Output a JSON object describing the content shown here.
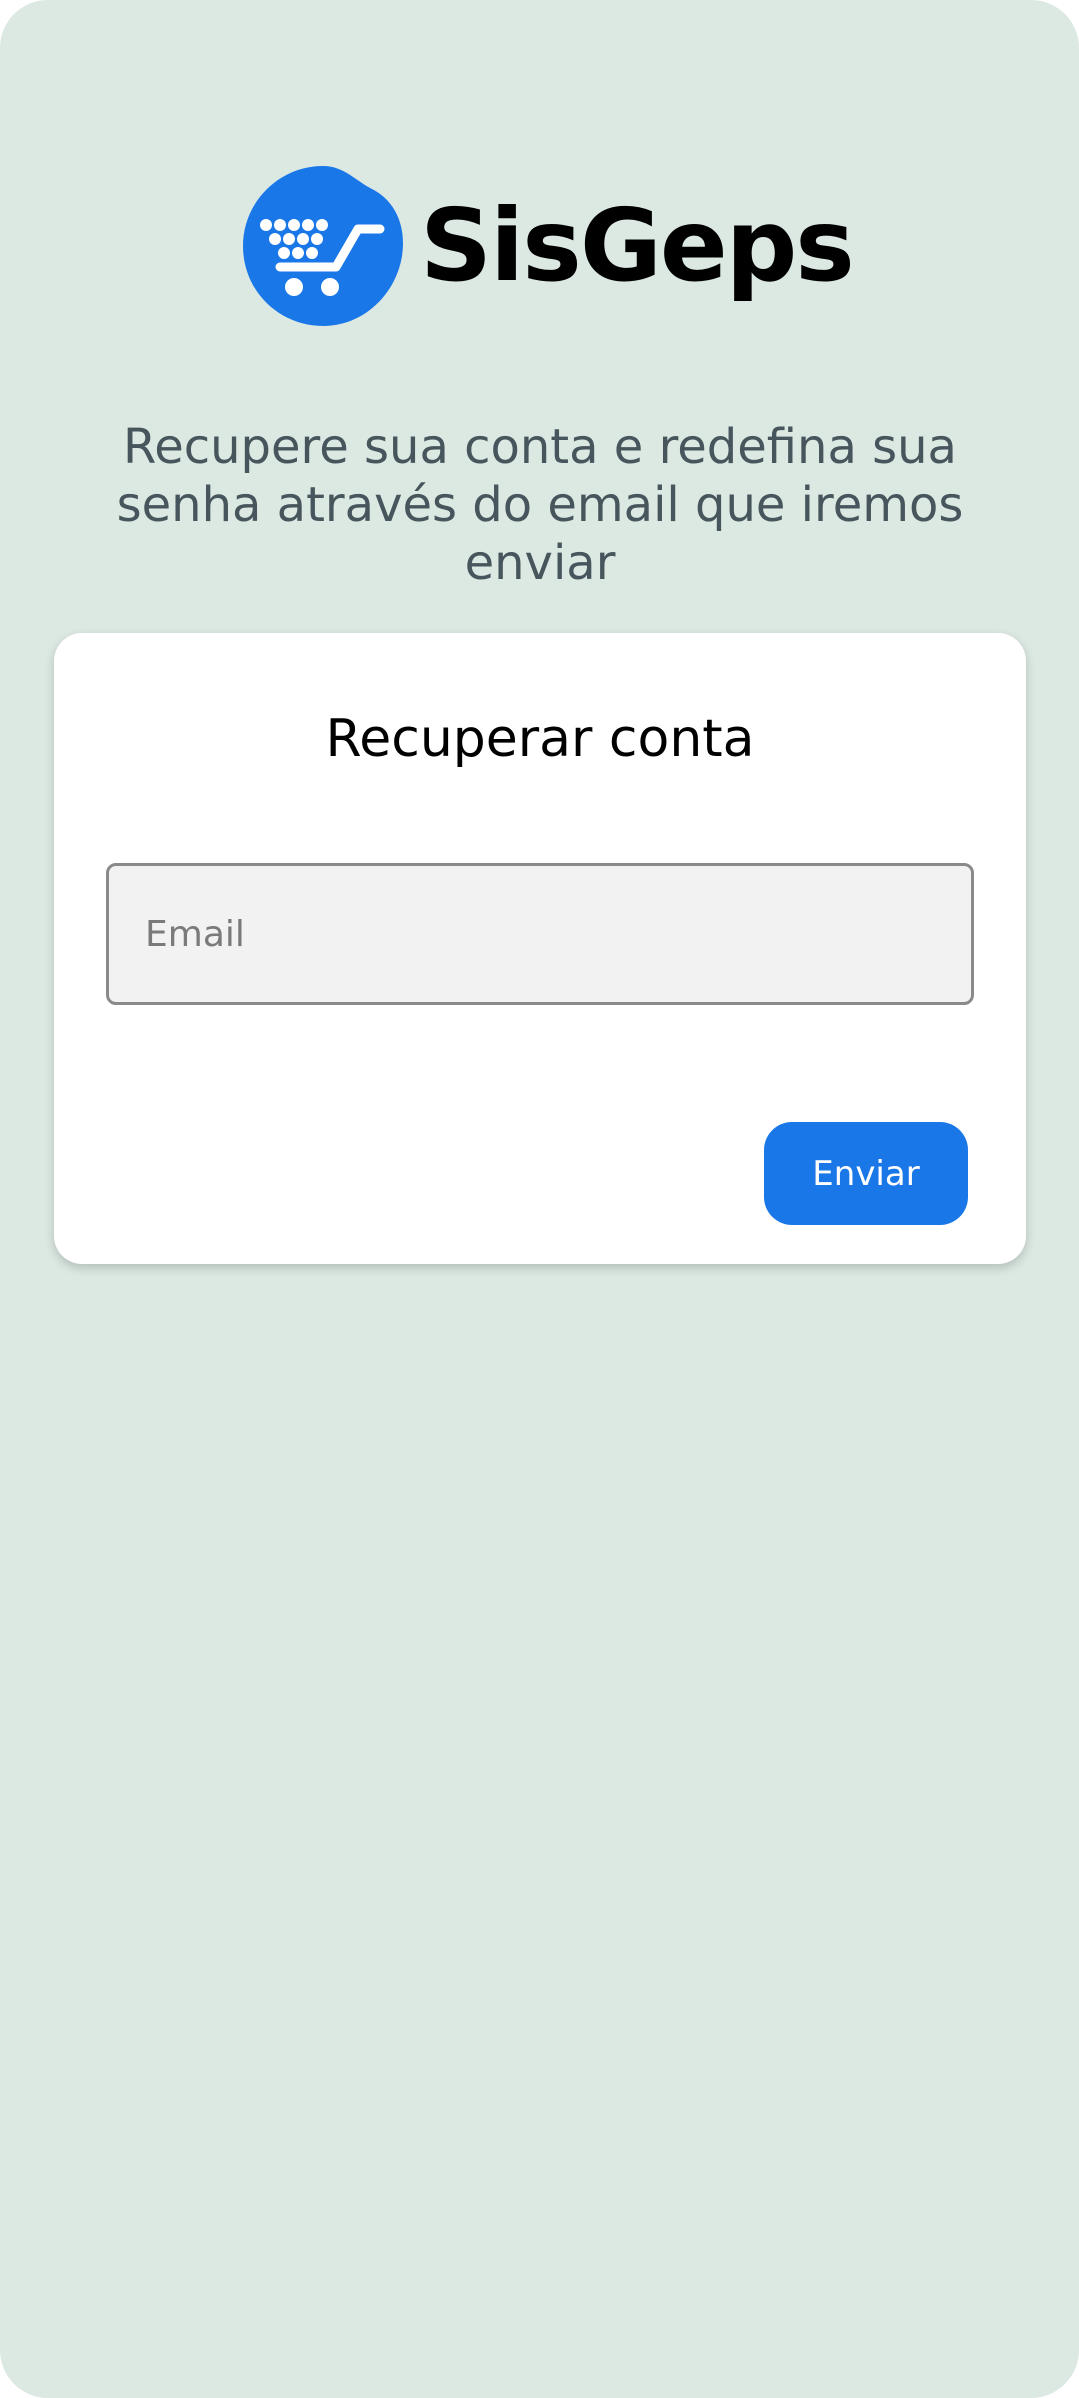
{
  "brand": {
    "name": "SisGeps",
    "logo_icon": "shopping-cart-icon",
    "color": "#1a77e8"
  },
  "tagline": "Recupere sua conta e redefina sua senha através do email que iremos enviar",
  "card": {
    "title": "Recuperar conta",
    "email": {
      "value": "",
      "placeholder": "Email"
    },
    "submit_label": "Enviar"
  },
  "colors": {
    "background": "#dce8e2",
    "accent": "#1a77e8",
    "text_muted": "#47555c"
  }
}
